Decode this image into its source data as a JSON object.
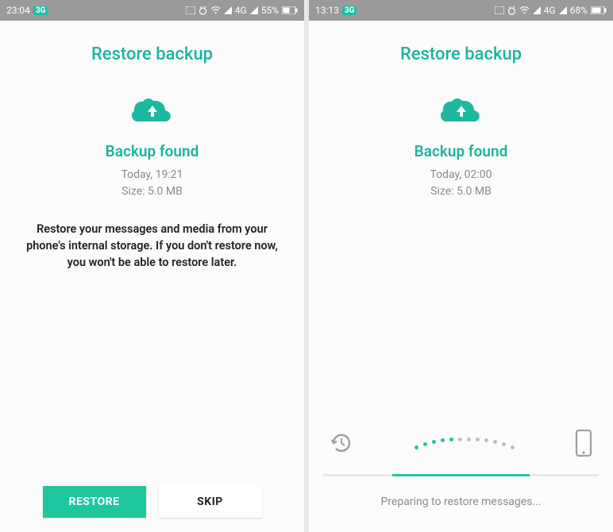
{
  "screens": [
    {
      "statusbar": {
        "time": "23:04",
        "badge": "3G",
        "net": "4G",
        "battery": "55%"
      },
      "title": "Restore backup",
      "subtitle": "Backup found",
      "timestamp": "Today, 19:21",
      "size": "Size: 5.0 MB",
      "description": "Restore your messages and media from your phone's internal storage. If you don't restore now, you won't be able to restore later.",
      "restore_label": "RESTORE",
      "skip_label": "SKIP"
    },
    {
      "statusbar": {
        "time": "13:13",
        "badge": "3G",
        "net": "4G",
        "battery": "68%"
      },
      "title": "Restore backup",
      "subtitle": "Backup found",
      "timestamp": "Today, 02:00",
      "size": "Size: 5.0 MB",
      "status": "Preparing to restore messages..."
    }
  ]
}
